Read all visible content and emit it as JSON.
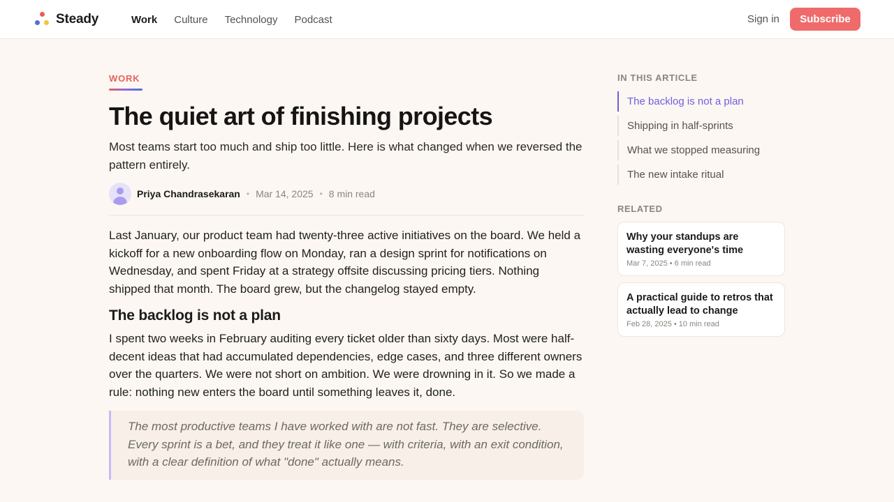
{
  "brand": {
    "name": "Steady",
    "colors": {
      "accent": "#ef6b6b",
      "toc_active": "#6f5fe0",
      "dot_red": "#f05a5a",
      "dot_blue": "#4f6fd8",
      "dot_yellow": "#f4c542"
    }
  },
  "nav": {
    "items": [
      {
        "label": "Work",
        "active": true
      },
      {
        "label": "Culture"
      },
      {
        "label": "Technology"
      },
      {
        "label": "Podcast"
      }
    ],
    "signin": "Sign in",
    "subscribe": "Subscribe"
  },
  "article": {
    "category": "WORK",
    "title": "The quiet art of finishing projects",
    "subtitle": "Most teams start too much and ship too little. Here is what changed when we reversed the pattern entirely.",
    "author": "Priya Chandrasekaran",
    "date": "Mar 14, 2025",
    "read_time": "8 min read",
    "separator": "•",
    "intro": "Last January, our product team had twenty-three active initiatives on the board. We held a kickoff for a new onboarding flow on Monday, ran a design sprint for notifications on Wednesday, and spent Friday at a strategy offsite discussing pricing tiers. Nothing shipped that month. The board grew, but the changelog stayed empty.",
    "section1_heading": "The backlog is not a plan",
    "section1_body": "I spent two weeks in February auditing every ticket older than sixty days. Most were half-decent ideas that had accumulated dependencies, edge cases, and three different owners over the quarters. We were not short on ambition. We were drowning in it. So we made a rule: nothing new enters the board until something leaves it, done.",
    "quote": "The most productive teams I have worked with are not fast. They are selective. Every sprint is a bet, and they treat it like one — with criteria, with an exit condition, with a clear definition of what \"done\" actually means."
  },
  "sidebar": {
    "toc_label": "IN THIS ARTICLE",
    "toc": [
      {
        "label": "The backlog is not a plan",
        "active": true
      },
      {
        "label": "Shipping in half-sprints"
      },
      {
        "label": "What we stopped measuring"
      },
      {
        "label": "The new intake ritual"
      }
    ],
    "related_label": "RELATED",
    "related": [
      {
        "title": "Why your standups are wasting everyone's time",
        "meta": "Mar 7, 2025 • 6 min read"
      },
      {
        "title": "A practical guide to retros that actually lead to change",
        "meta": "Feb 28, 2025 • 10 min read"
      }
    ]
  }
}
